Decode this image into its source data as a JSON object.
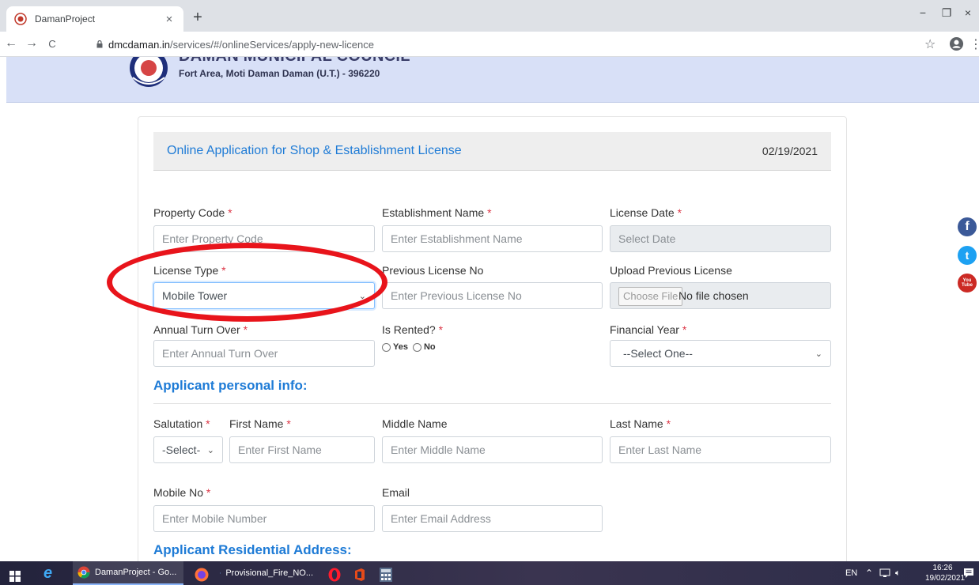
{
  "browser": {
    "tab_title": "DamanProject",
    "tab_close": "×",
    "new_tab": "+",
    "minimize": "−",
    "maximize": "❐",
    "close": "×",
    "back": "←",
    "forward": "→",
    "reload": "C",
    "url_host": "dmcdaman.in",
    "url_path": "/services/#/onlineServices/apply-new-licence",
    "bookmark_star": "☆",
    "menu": "⋮"
  },
  "header": {
    "council_name": "DAMAN MUNICIPAL COUNCIL",
    "address": "Fort Area, Moti Daman Daman (U.T.) - 396220"
  },
  "form": {
    "title": "Online Application for Shop & Establishment License",
    "date": "02/19/2021",
    "required_mark": "*",
    "property_code": {
      "label": "Property Code ",
      "placeholder": "Enter Property Code"
    },
    "establishment_name": {
      "label": "Establishment Name ",
      "placeholder": "Enter Establishment Name"
    },
    "license_date": {
      "label": "License Date ",
      "placeholder": "Select Date"
    },
    "license_type": {
      "label": "License Type ",
      "value": "Mobile Tower"
    },
    "previous_license_no": {
      "label": "Previous License No",
      "placeholder": "Enter Previous License No"
    },
    "upload_previous_license": {
      "label": "Upload Previous License",
      "button": "Choose File",
      "status": "No file chosen"
    },
    "annual_turnover": {
      "label": "Annual Turn Over ",
      "placeholder": "Enter Annual Turn Over"
    },
    "is_rented": {
      "label": "Is Rented? ",
      "yes": "Yes",
      "no": "No"
    },
    "financial_year": {
      "label": "Financial Year ",
      "value": "--Select One--"
    },
    "personal_section": "Applicant personal info:",
    "salutation": {
      "label": "Salutation ",
      "value": "-Select-"
    },
    "first_name": {
      "label": "First Name ",
      "placeholder": "Enter First Name"
    },
    "middle_name": {
      "label": "Middle Name",
      "placeholder": "Enter Middle Name"
    },
    "last_name": {
      "label": "Last Name ",
      "placeholder": "Enter Last Name"
    },
    "mobile_no": {
      "label": "Mobile No ",
      "placeholder": "Enter Mobile Number"
    },
    "email": {
      "label": "Email",
      "placeholder": "Enter Email Address"
    },
    "address_section": "Applicant Residential Address:"
  },
  "social": {
    "facebook": "f",
    "twitter": "t",
    "youtube": "You Tube"
  },
  "taskbar": {
    "chrome_label": "DamanProject - Go...",
    "word_label": "Provisional_Fire_NO...",
    "language": "EN",
    "time": "16:26",
    "date": "19/02/2021"
  },
  "colors": {
    "accent": "#1e7bd6",
    "required": "#dc3545",
    "header_bg": "#d8e0f7",
    "annotation": "#e8141b"
  }
}
